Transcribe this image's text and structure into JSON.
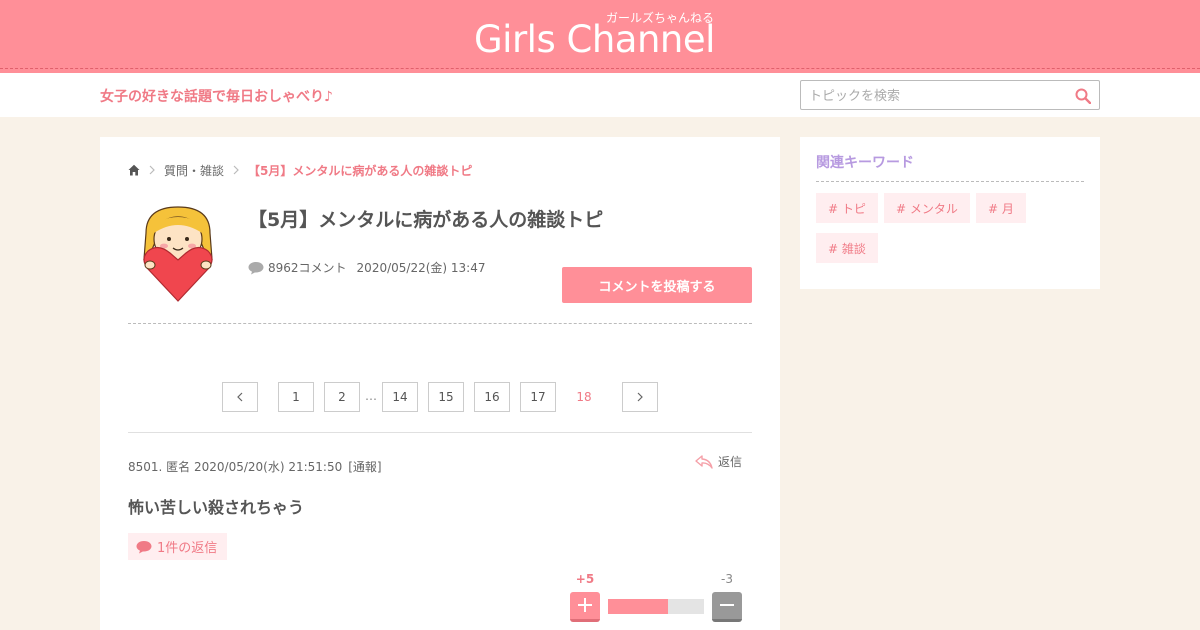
{
  "header": {
    "logo": "Girls Channel",
    "logo_sub": "ガールズちゃんねる",
    "tagline": "女子の好きな話題で毎日おしゃべり♪"
  },
  "search": {
    "placeholder": "トピックを検索"
  },
  "breadcrumb": {
    "category": "質問・雑談",
    "current": "【5月】メンタルに病がある人の雑談トピ"
  },
  "topic": {
    "title": "【5月】メンタルに病がある人の雑談トピ",
    "comment_count": "8962コメント",
    "date": "2020/05/22(金) 13:47",
    "post_button": "コメントを投稿する"
  },
  "pagination": {
    "pages": [
      "1",
      "2",
      "14",
      "15",
      "16",
      "17"
    ],
    "ellipsis": "…",
    "current": "18"
  },
  "comment": {
    "header": "8501. 匿名 2020/05/20(水) 21:51:50",
    "report": "[通報]",
    "reply_label": "返信",
    "body": "怖い苦しい殺されちゃう",
    "reply_count": "1件の返信",
    "plus": "+5",
    "minus": "-3",
    "plus_fraction": 0.625
  },
  "sidebar": {
    "title": "関連キーワード",
    "tags": [
      "# トピ",
      "# メンタル",
      "# 月",
      "# 雑談"
    ]
  },
  "colors": {
    "brand_pink": "#ff8f98",
    "accent_text": "#f07a86",
    "sidebar_title": "#b79ae0",
    "background": "#f9f2e8"
  }
}
